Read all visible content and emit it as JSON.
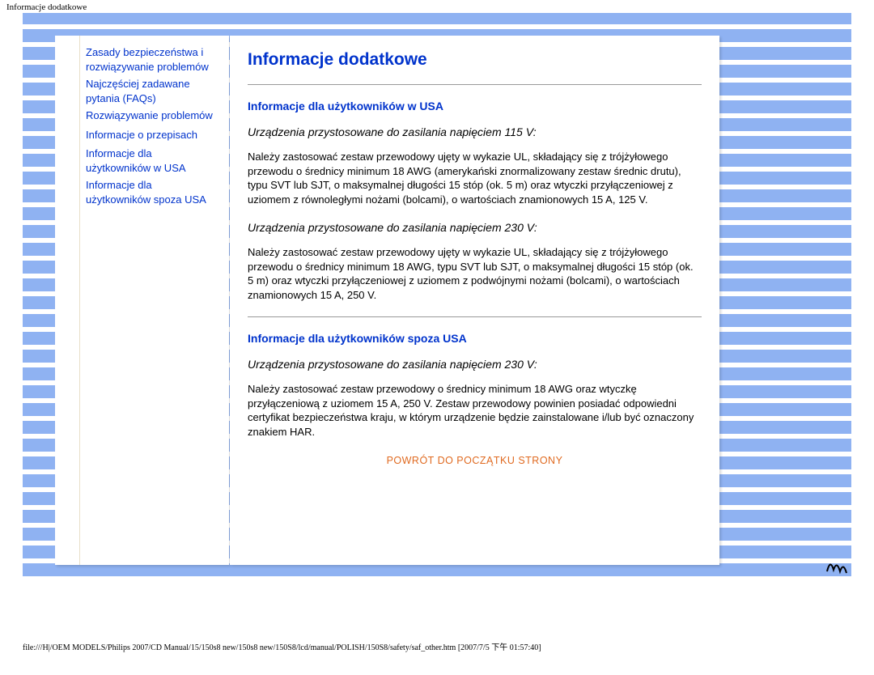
{
  "page_label": "Informacje dodatkowe",
  "sidebar": {
    "links": [
      {
        "label": "Zasady bezpieczeństwa i rozwiązywanie problemów"
      },
      {
        "label": "Najczęściej  zadawane pytania (FAQs)"
      },
      {
        "label": "Rozwiązywanie problemów"
      },
      {
        "label": "Informacje o przepisach"
      },
      {
        "label": "Informacje dla użytkowników w USA"
      },
      {
        "label": "Informacje dla użytkowników spoza USA"
      }
    ]
  },
  "content": {
    "title": "Informacje dodatkowe",
    "section1": {
      "heading": "Informacje dla użytkowników w USA",
      "sub1": "Urządzenia przystosowane do zasilania napięciem 115 V:",
      "para1": "Należy zastosować zestaw przewodowy ujęty w wykazie UL, składający się z trójżyłowego przewodu o średnicy minimum 18 AWG (amerykański znormalizowany zestaw średnic drutu), typu SVT lub SJT, o maksymalnej długości 15 stóp (ok. 5 m) oraz wtyczki przyłączeniowej z uziomem z równoległymi nożami (bolcami), o wartościach znamionowych 15 A, 125 V.",
      "sub2": "Urządzenia przystosowane do zasilania napięciem 230 V:",
      "para2": "Należy zastosować zestaw przewodowy ujęty w wykazie UL, składający się z trójżyłowego przewodu o średnicy minimum 18 AWG, typu SVT lub SJT, o maksymalnej długości 15 stóp (ok. 5 m) oraz wtyczki przyłączeniowej z uziomem z podwójnymi nożami (bolcami), o wartościach znamionowych 15 A, 250 V."
    },
    "section2": {
      "heading": "Informacje dla użytkowników spoza USA",
      "sub1": "Urządzenia przystosowane do zasilania napięciem 230 V:",
      "para1": "Należy zastosować zestaw przewodowy o średnicy minimum 18 AWG oraz wtyczkę przyłączeniową z uziomem 15 A, 250 V. Zestaw przewodowy powinien posiadać odpowiedni certyfikat bezpieczeństwa kraju, w którym urządzenie będzie zainstalowane i/lub być oznaczony znakiem HAR."
    },
    "back_to_top": "POWRÓT DO POCZĄTKU STRONY"
  },
  "footer_path": "file:///H|/OEM MODELS/Philips 2007/CD Manual/15/150s8 new/150s8 new/150S8/lcd/manual/POLISH/150S8/safety/saf_other.htm [2007/7/5 下午 01:57:40]"
}
